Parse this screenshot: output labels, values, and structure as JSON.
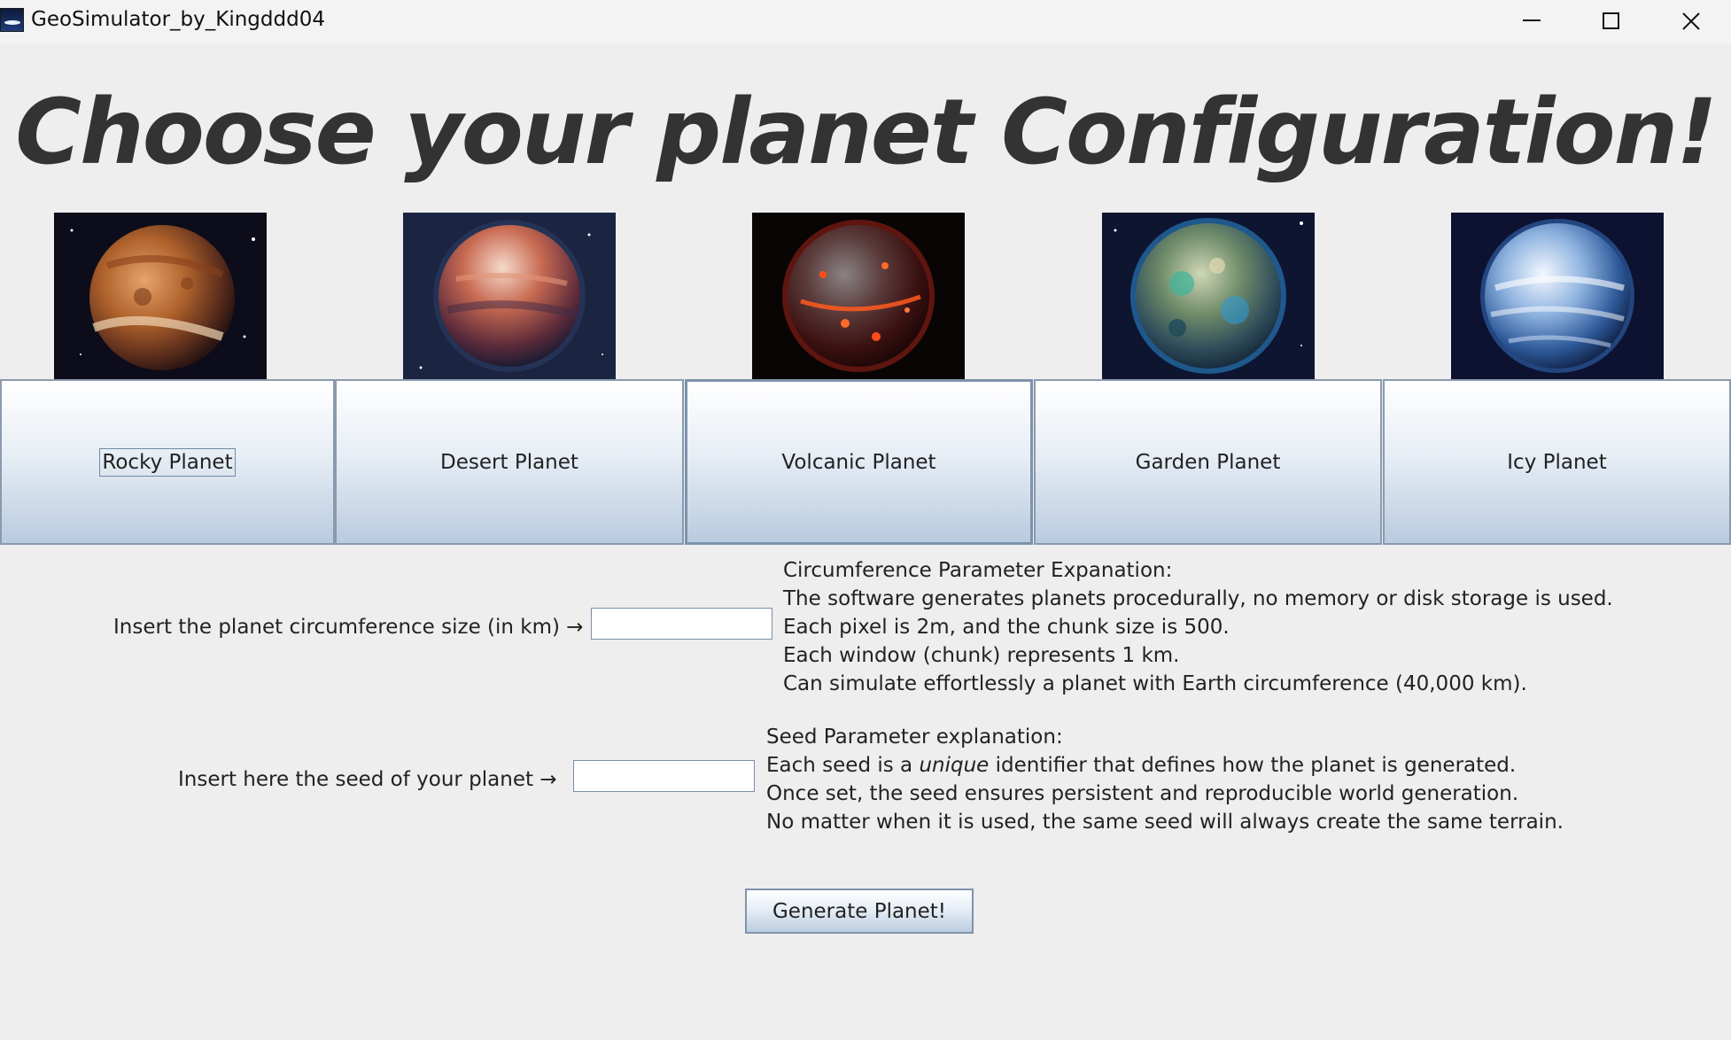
{
  "window": {
    "title": "GeoSimulator_by_Kingddd04"
  },
  "heading": "Choose your planet Configuration!",
  "planets": [
    {
      "label": "Rocky Planet",
      "icon": "rocky-planet-image"
    },
    {
      "label": "Desert Planet",
      "icon": "desert-planet-image"
    },
    {
      "label": "Volcanic Planet",
      "icon": "volcanic-planet-image"
    },
    {
      "label": "Garden Planet",
      "icon": "garden-planet-image"
    },
    {
      "label": "Icy Planet",
      "icon": "icy-planet-image"
    }
  ],
  "circumference": {
    "label": "Insert the planet circumference size (in km) →",
    "value": "",
    "info_title": "Circumference Parameter Expanation:",
    "info_lines": [
      "The software generates planets procedurally, no memory or disk storage is used.",
      "Each pixel is 2m, and the chunk size is 500.",
      "Each window (chunk) represents 1 km.",
      "Can simulate effortlessly a planet with Earth circumference (40,000 km)."
    ]
  },
  "seed": {
    "label": "Insert here the seed of your planet  →",
    "value": "",
    "info_title": "Seed Parameter explanation:",
    "info_line1_before": "Each seed is a ",
    "info_line1_emph": "unique",
    "info_line1_after": " identifier that defines how the planet is generated.",
    "info_lines": [
      "Once set, the seed ensures persistent and reproducible world generation.",
      "No matter when it is used, the same seed will always create the same terrain."
    ]
  },
  "generate_label": "Generate Planet!"
}
